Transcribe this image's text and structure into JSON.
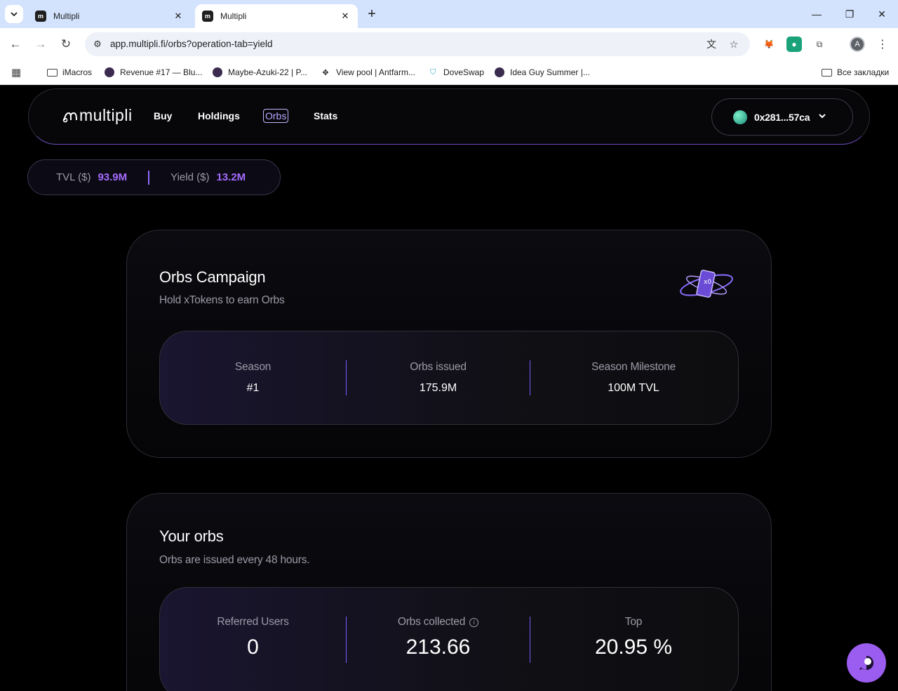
{
  "browser": {
    "tabs": [
      {
        "title": "Multipli",
        "favicon": "m"
      },
      {
        "title": "Multipli",
        "favicon": "m"
      }
    ],
    "url": "app.multipli.fi/orbs?operation-tab=yield",
    "bookmarks": [
      {
        "label": "iMacros",
        "icon": "folder-icon"
      },
      {
        "label": "Revenue #17 — Blu...",
        "icon": "eye-icon"
      },
      {
        "label": "Maybe-Azuki-22 | P...",
        "icon": "eye-icon"
      },
      {
        "label": "View pool | Antfarm...",
        "icon": "antfarm-icon"
      },
      {
        "label": "DoveSwap",
        "icon": "doveswap-icon"
      },
      {
        "label": "Idea Guy Summer |...",
        "icon": "eye-icon"
      }
    ],
    "all_bookmarks": "Все закладки",
    "profile_initial": "A"
  },
  "nav": {
    "brand": "multipli",
    "links": [
      "Buy",
      "Holdings",
      "Orbs",
      "Stats"
    ],
    "active": "Orbs",
    "wallet": "0x281...57ca"
  },
  "stats": {
    "tvl_label": "TVL ($)",
    "tvl_value": "93.9M",
    "yield_label": "Yield ($)",
    "yield_value": "13.2M"
  },
  "campaign": {
    "title": "Orbs Campaign",
    "subtitle": "Hold xTokens to earn Orbs",
    "items": [
      {
        "label": "Season",
        "value": "#1"
      },
      {
        "label": "Orbs issued",
        "value": "175.9M"
      },
      {
        "label": "Season Milestone",
        "value": "100M TVL"
      }
    ]
  },
  "your_orbs": {
    "title": "Your orbs",
    "subtitle": "Orbs are issued every 48 hours.",
    "items": [
      {
        "label": "Referred Users",
        "value": "0"
      },
      {
        "label": "Orbs collected",
        "value": "213.66"
      },
      {
        "label": "Top",
        "value": "20.95 %"
      }
    ]
  },
  "colors": {
    "accent": "#a56cff",
    "chat_button": "#9b5cf0",
    "separator": "#7b5cff"
  }
}
